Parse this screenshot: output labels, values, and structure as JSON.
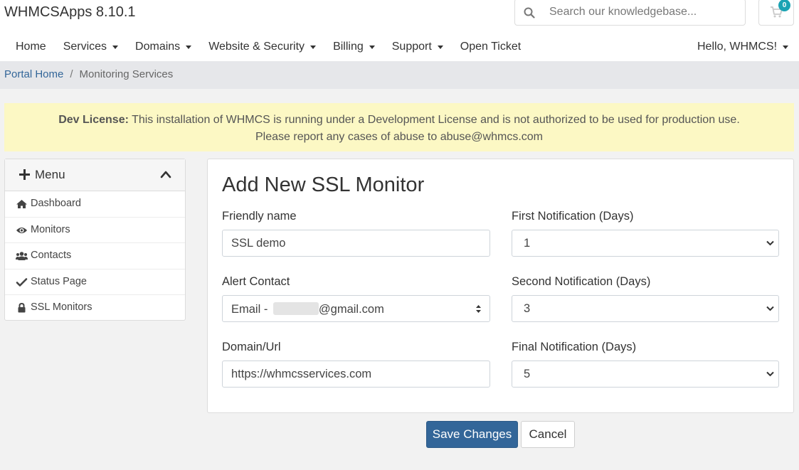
{
  "header": {
    "brand": "WHMCSApps 8.10.1",
    "search": {
      "placeholder": "Search our knowledgebase...",
      "icon": "search-icon"
    },
    "cart": {
      "count": "0",
      "icon": "cart-icon",
      "badge_color": "#1ba3b3"
    }
  },
  "nav": {
    "items": [
      {
        "label": "Home",
        "dropdown": false
      },
      {
        "label": "Services",
        "dropdown": true
      },
      {
        "label": "Domains",
        "dropdown": true
      },
      {
        "label": "Website & Security",
        "dropdown": true
      },
      {
        "label": "Billing",
        "dropdown": true
      },
      {
        "label": "Support",
        "dropdown": true
      },
      {
        "label": "Open Ticket",
        "dropdown": false
      }
    ],
    "user_menu": "Hello, WHMCS!"
  },
  "breadcrumb": {
    "home": "Portal Home",
    "separator": "/",
    "current": "Monitoring Services"
  },
  "dev_alert": {
    "strong": "Dev License:",
    "line1": " This installation of WHMCS is running under a Development License and is not authorized to be used for production use.",
    "line2": "Please report any cases of abuse to abuse@whmcs.com",
    "background": "#fcf8c4"
  },
  "sidebar": {
    "title": "Menu",
    "items": [
      {
        "label": "Dashboard",
        "icon": "home-icon"
      },
      {
        "label": "Monitors",
        "icon": "eye-icon"
      },
      {
        "label": "Contacts",
        "icon": "users-icon"
      },
      {
        "label": "Status Page",
        "icon": "check-icon"
      },
      {
        "label": "SSL Monitors",
        "icon": "lock-icon"
      }
    ]
  },
  "form": {
    "title": "Add New SSL Monitor",
    "friendly_name": {
      "label": "Friendly name",
      "value": "SSL demo"
    },
    "alert_contact": {
      "label": "Alert Contact",
      "value_prefix": "Email - ",
      "value_suffix": "@gmail.com"
    },
    "domain": {
      "label": "Domain/Url",
      "value": "https://whmcsservices.com"
    },
    "first_notification": {
      "label": "First Notification (Days)",
      "value": "1"
    },
    "second_notification": {
      "label": "Second Notification (Days)",
      "value": "3"
    },
    "final_notification": {
      "label": "Final Notification (Days)",
      "value": "5"
    }
  },
  "actions": {
    "save": "Save Changes",
    "cancel": "Cancel",
    "primary_color": "#336699"
  }
}
